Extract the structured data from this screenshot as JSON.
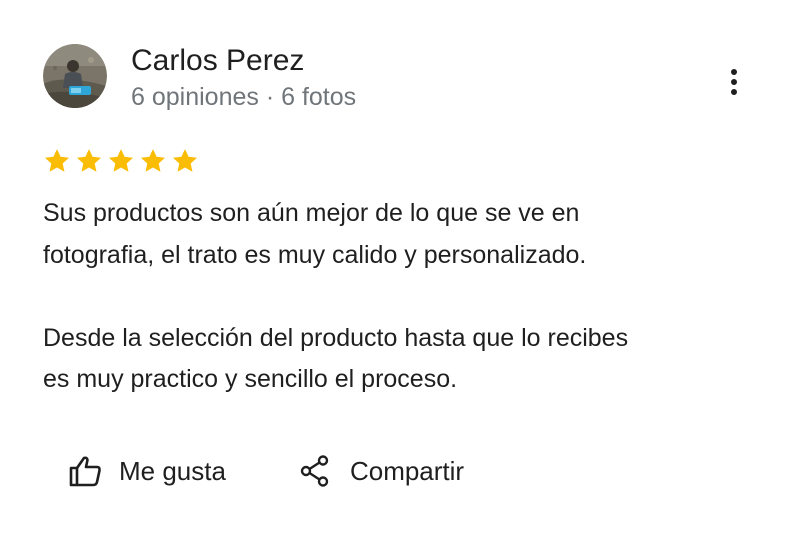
{
  "review": {
    "author": {
      "name": "Carlos Perez",
      "meta": "6 opiniones · 6 fotos",
      "avatar_icon": "profile-photo"
    },
    "menu_icon": "more-vert-icon",
    "rating": {
      "value": 5,
      "max": 5,
      "star_color": "#fbbc04"
    },
    "text_paragraphs": [
      "Sus productos son aún mejor de lo que se ve en\nfotografia, el trato es muy calido y personalizado.",
      "Desde la selección del producto hasta que lo recibes\nes muy practico y sencillo el proceso."
    ],
    "actions": {
      "like_label": "Me gusta",
      "like_icon": "thumb-up-icon",
      "share_label": "Compartir",
      "share_icon": "share-icon"
    }
  }
}
